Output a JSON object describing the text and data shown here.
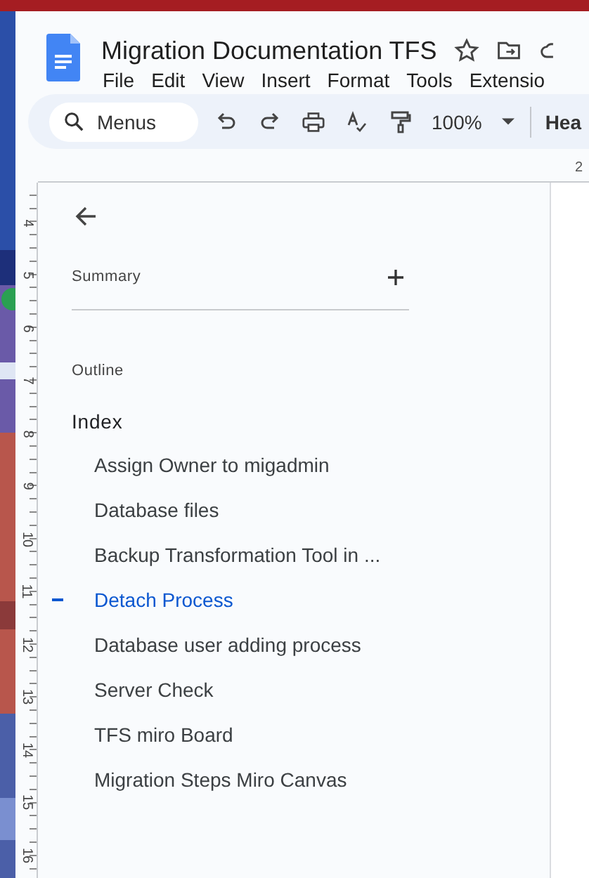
{
  "document": {
    "title": "Migration Documentation TFS"
  },
  "menu": [
    "File",
    "Edit",
    "View",
    "Insert",
    "Format",
    "Tools",
    "Extensio"
  ],
  "toolbar": {
    "search": {
      "placeholder": "Menus"
    },
    "zoom": "100%",
    "style": "Hea"
  },
  "top_ruler": [
    "2"
  ],
  "side_ruler": [
    "4",
    "5",
    "6",
    "7",
    "8",
    "9",
    "10",
    "11",
    "12",
    "13",
    "14",
    "15",
    "16"
  ],
  "outline_panel": {
    "summary_label": "Summary",
    "outline_label": "Outline",
    "heading": "Index",
    "items": [
      {
        "label": "Assign Owner to migadmin",
        "selected": false
      },
      {
        "label": "Database files",
        "selected": false
      },
      {
        "label": "Backup Transformation Tool in ...",
        "selected": false
      },
      {
        "label": "Detach Process",
        "selected": true
      },
      {
        "label": "Database user adding process",
        "selected": false
      },
      {
        "label": "Server Check",
        "selected": false
      },
      {
        "label": "TFS miro Board",
        "selected": false
      },
      {
        "label": "Migration Steps Miro Canvas",
        "selected": false
      }
    ]
  }
}
